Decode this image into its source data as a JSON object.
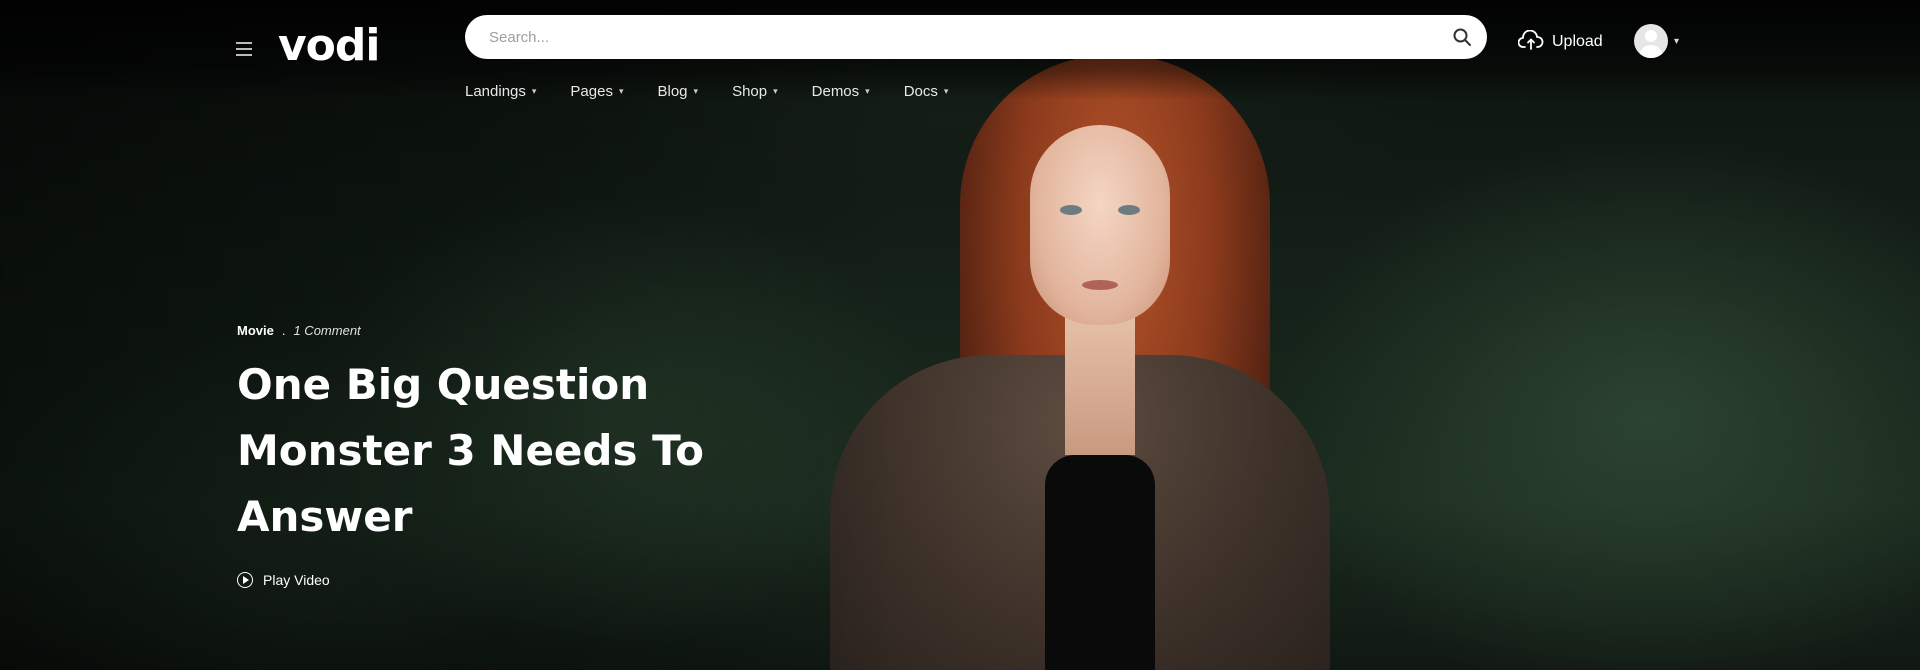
{
  "header": {
    "logo": "vodi",
    "search_placeholder": "Search...",
    "upload_label": "Upload",
    "icons": {
      "menu": "hamburger-icon",
      "search": "search-icon",
      "upload": "cloud-upload-icon",
      "avatar": "user-avatar-icon",
      "dropdown": "chevron-down-icon"
    }
  },
  "nav": {
    "items": [
      {
        "label": "Landings"
      },
      {
        "label": "Pages"
      },
      {
        "label": "Blog"
      },
      {
        "label": "Shop"
      },
      {
        "label": "Demos"
      },
      {
        "label": "Docs"
      }
    ]
  },
  "hero": {
    "category": "Movie",
    "separator": ".",
    "comments": "1 Comment",
    "title_lines": [
      "One Big Question",
      "Monster 3 Needs To",
      "Answer"
    ],
    "play_label": "Play Video"
  },
  "colors": {
    "search_bg": "#ffffff",
    "text": "#ffffff",
    "background": "#142018"
  }
}
